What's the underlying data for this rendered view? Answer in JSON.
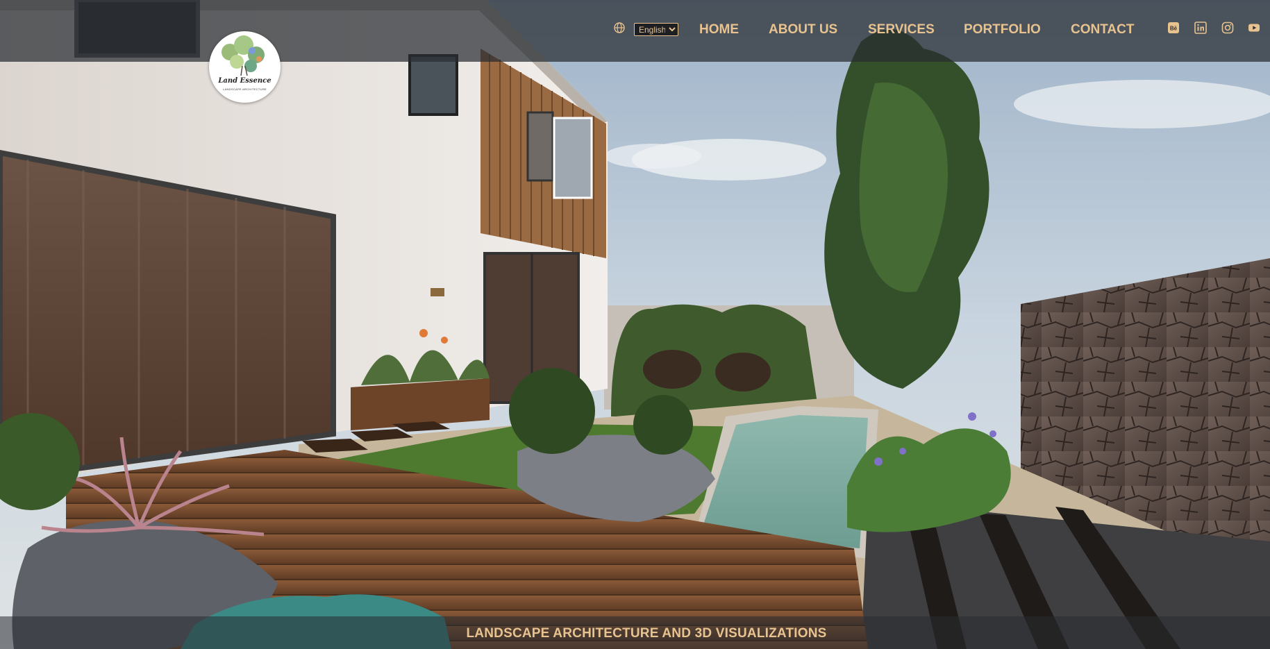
{
  "brand": {
    "logo_title": "Land Essence",
    "logo_subtitle": "LANDSCAPE ARCHITECTURE"
  },
  "language": {
    "icon": "globe-icon",
    "selected": "English"
  },
  "nav": {
    "home": "HOME",
    "about": "ABOUT US",
    "services": "SERVICES",
    "portfolio": "PORTFOLIO",
    "contact": "CONTACT"
  },
  "social": {
    "icons": [
      "behance-icon",
      "linkedin-icon",
      "instagram-icon",
      "youtube-icon"
    ],
    "behance_text": "Bē"
  },
  "hero": {
    "tagline": "LANDSCAPE ARCHITECTURE AND 3D VISUALIZATIONS"
  },
  "colors": {
    "accent": "#e8c38f",
    "header_overlay": "#282c32"
  }
}
